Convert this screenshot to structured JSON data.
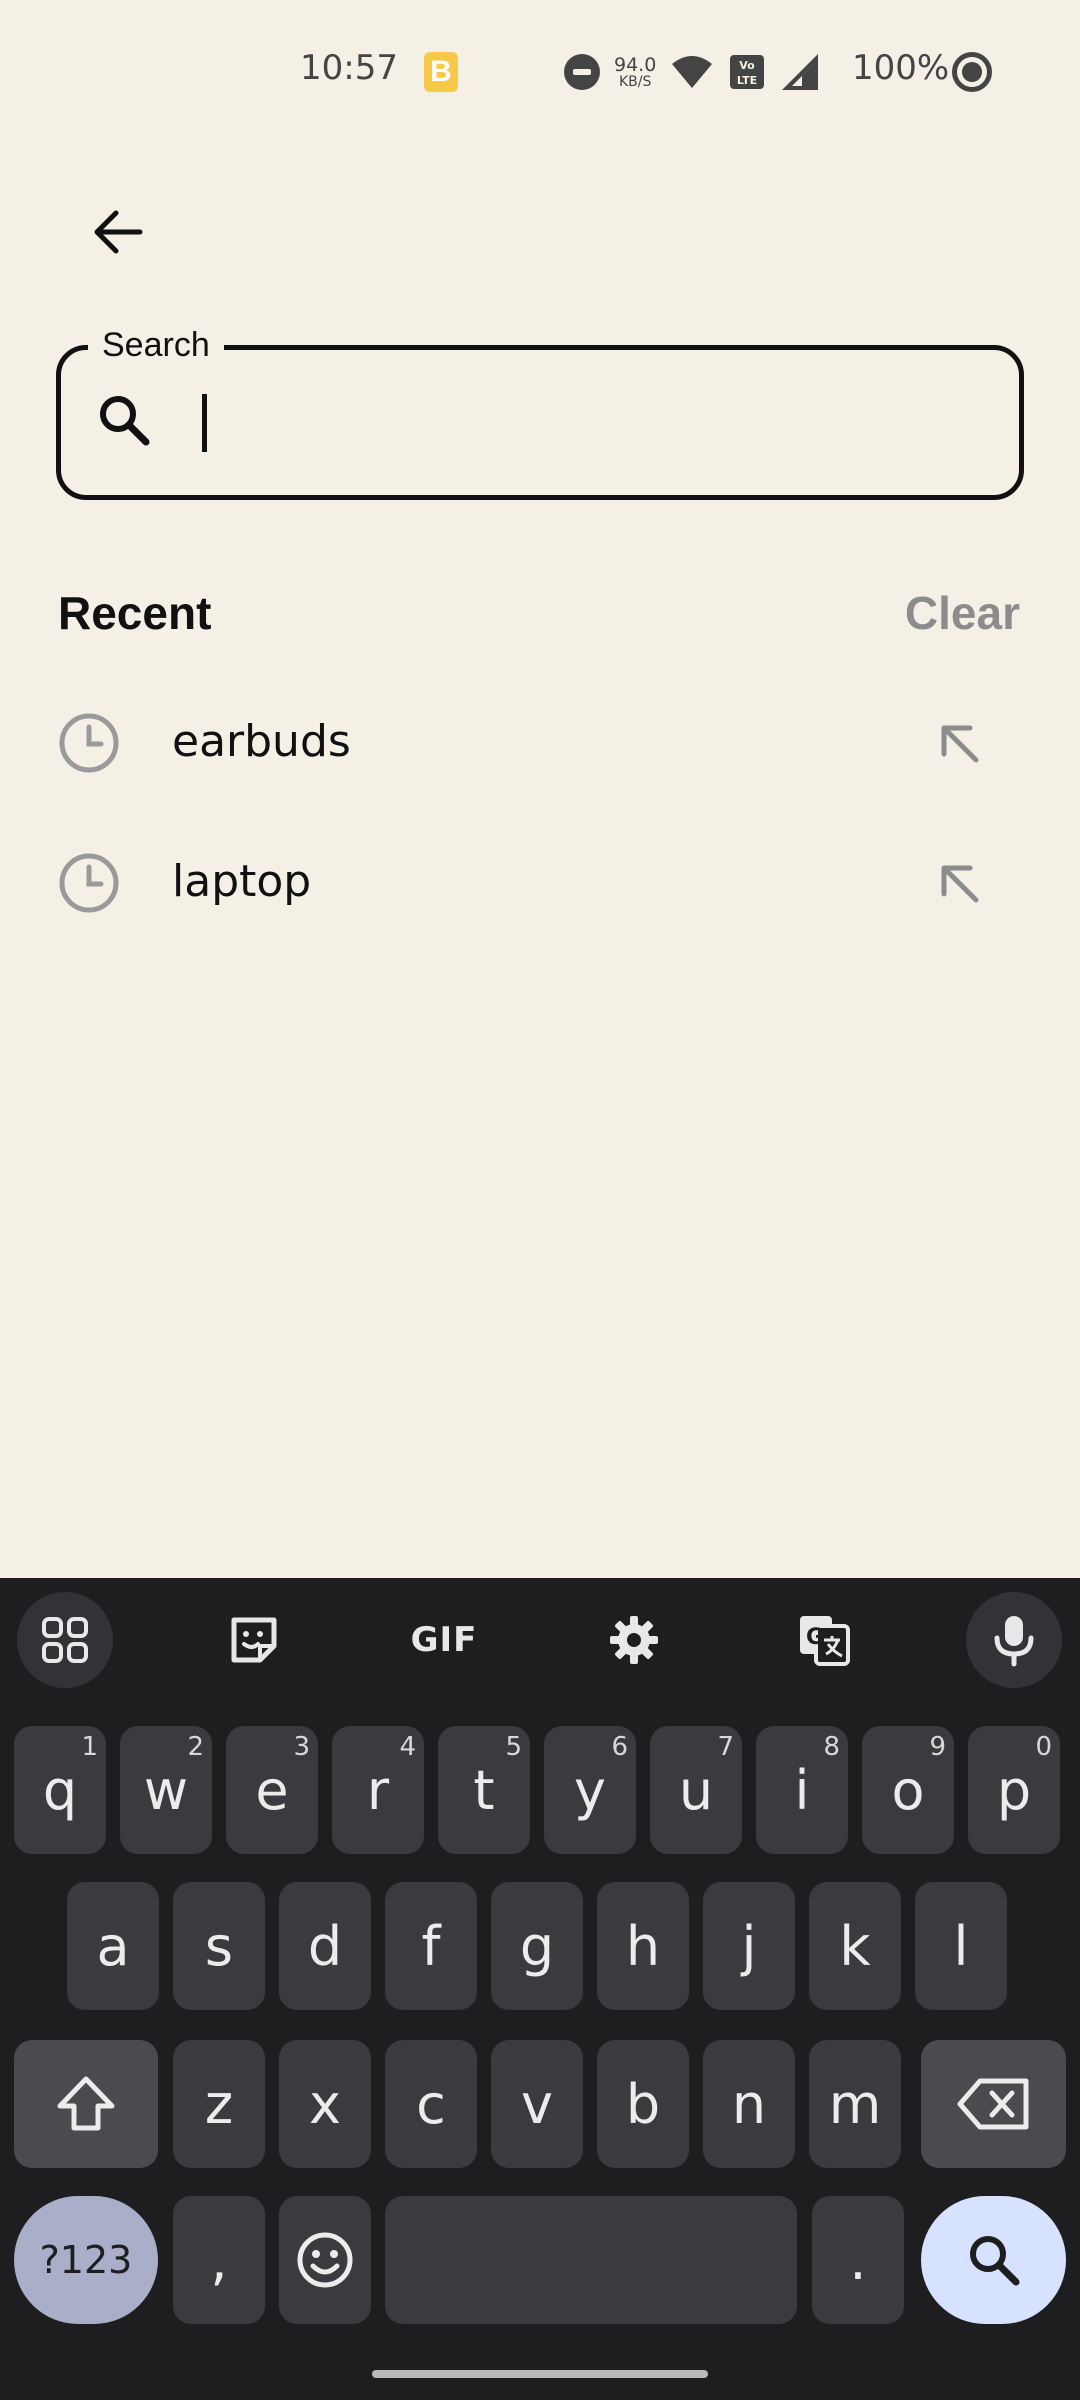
{
  "status_bar": {
    "time": "10:57",
    "app_icon_letter": "B",
    "speed_value": "94.0",
    "speed_unit": "KB/S",
    "volte_label": "Vo LTE",
    "battery": "100%"
  },
  "search": {
    "label": "Search",
    "value": "",
    "placeholder": ""
  },
  "recent": {
    "heading": "Recent",
    "clear_label": "Clear",
    "items": [
      {
        "label": "earbuds"
      },
      {
        "label": "laptop"
      }
    ]
  },
  "keyboard": {
    "toolbar": {
      "gif_label": "GIF"
    },
    "row1": [
      {
        "key": "q",
        "hint": "1"
      },
      {
        "key": "w",
        "hint": "2"
      },
      {
        "key": "e",
        "hint": "3"
      },
      {
        "key": "r",
        "hint": "4"
      },
      {
        "key": "t",
        "hint": "5"
      },
      {
        "key": "y",
        "hint": "6"
      },
      {
        "key": "u",
        "hint": "7"
      },
      {
        "key": "i",
        "hint": "8"
      },
      {
        "key": "o",
        "hint": "9"
      },
      {
        "key": "p",
        "hint": "0"
      }
    ],
    "row2": [
      "a",
      "s",
      "d",
      "f",
      "g",
      "h",
      "j",
      "k",
      "l"
    ],
    "row3": [
      "z",
      "x",
      "c",
      "v",
      "b",
      "n",
      "m"
    ],
    "symbols_label": "?123",
    "comma": ",",
    "period": "."
  },
  "colors": {
    "background": "#f5f0e6",
    "keyboard_bg": "#1e1e20",
    "key_bg": "#3b3b3f",
    "search_key_bg": "#d6e2ff",
    "symbols_key_bg": "#a9aec9",
    "muted_text": "#8c8c8c"
  }
}
